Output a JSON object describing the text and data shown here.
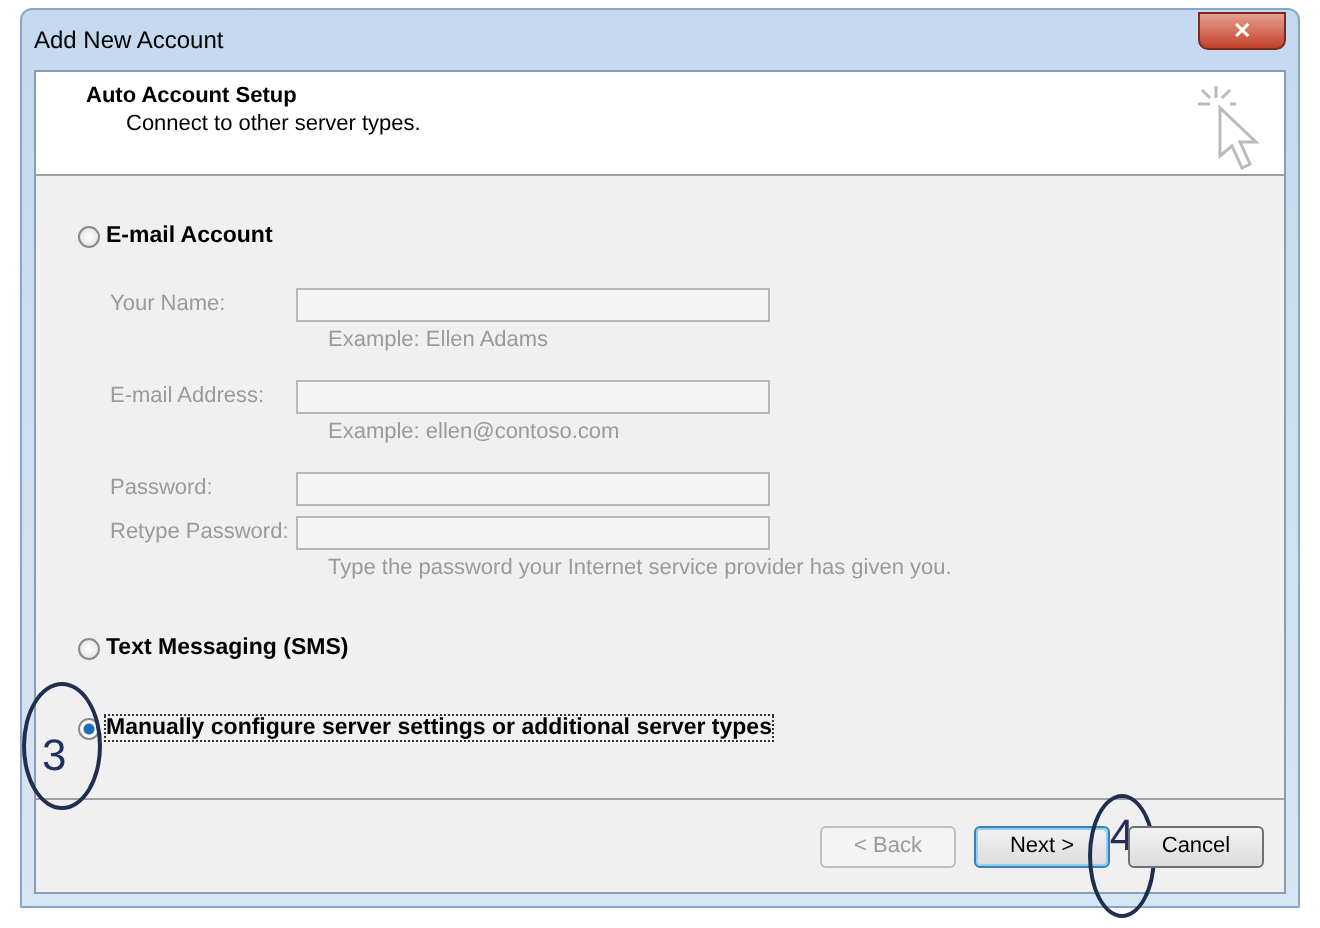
{
  "window": {
    "title": "Add New Account",
    "close": "✕"
  },
  "header": {
    "title": "Auto Account Setup",
    "subtitle": "Connect to other server types."
  },
  "options": [
    {
      "label": "E-mail Account",
      "selected": false,
      "fields_disabled": true,
      "fields": [
        {
          "label": "Your Name:",
          "note": "Example: Ellen Adams"
        },
        {
          "label": "E-mail Address:",
          "note": "Example: ellen@contoso.com"
        },
        {
          "label": "Password:"
        },
        {
          "label": "Retype Password:",
          "note": "Type the password your Internet service provider has given you."
        }
      ]
    },
    {
      "label": "Text Messaging (SMS)",
      "selected": false
    },
    {
      "label": "Manually configure server settings or additional server types",
      "selected": true,
      "annotation": "3"
    }
  ],
  "buttons": [
    {
      "label": "< Back",
      "disabled": true,
      "default": false
    },
    {
      "label": "Next >",
      "disabled": false,
      "default": true,
      "annotation": "4"
    },
    {
      "label": "Cancel",
      "disabled": false,
      "default": false
    }
  ]
}
